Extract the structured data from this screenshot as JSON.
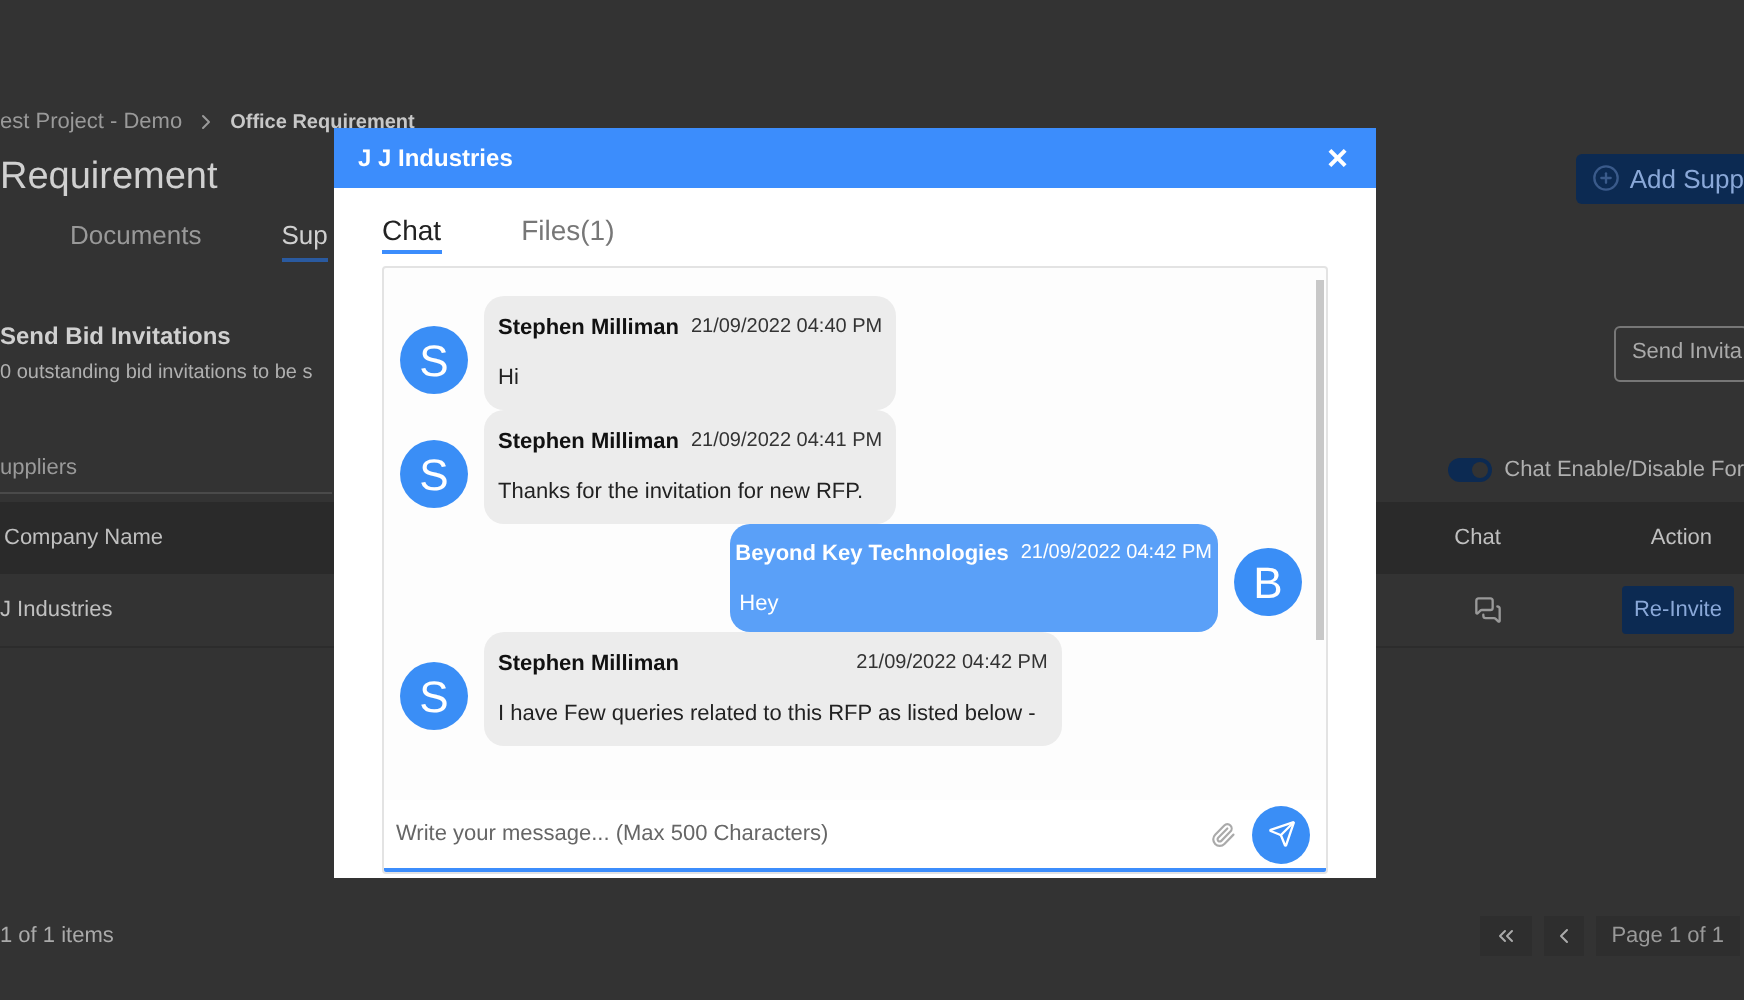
{
  "page": {
    "breadcrumb": [
      {
        "label": "est Project - Demo",
        "current": false
      },
      {
        "label": "Office Requirement",
        "current": true
      }
    ],
    "title": "Requirement",
    "add_button": "Add Supp",
    "tabs": [
      {
        "label": "Documents",
        "selected": false
      },
      {
        "label": "Sup",
        "selected": true
      }
    ],
    "section_title": "Send Bid Invitations",
    "section_subtitle": "0 outstanding bid invitations to be s",
    "send_button": "Send Invita",
    "search": {
      "placeholder": "uppliers"
    },
    "chat_toggle": {
      "label": "Chat Enable/Disable For",
      "on": true
    },
    "table": {
      "columns": [
        "Company Name",
        "Chat",
        "Action"
      ],
      "rows": [
        {
          "company": "J Industries",
          "action": "Re-Invite"
        }
      ]
    },
    "footer": {
      "count": "1 of 1 items",
      "page": "Page 1 of 1"
    }
  },
  "dialog": {
    "title": "J J Industries",
    "close": "×",
    "tabs": [
      {
        "label": "Chat",
        "selected": true
      },
      {
        "label": "Files(1)",
        "selected": false
      }
    ],
    "messages": [
      {
        "kind": "in",
        "avatar": "S",
        "sender": "Stephen Milliman",
        "time": "21/09/2022 04:40 PM",
        "text": "Hi"
      },
      {
        "kind": "in",
        "avatar": "S",
        "sender": "Stephen Milliman",
        "time": "21/09/2022 04:41 PM",
        "text": "Thanks for the invitation for new RFP."
      },
      {
        "kind": "out",
        "avatar": "B",
        "sender": "Beyond Key Technologies",
        "time": "21/09/2022 04:42 PM",
        "text": "Hey"
      },
      {
        "kind": "in",
        "avatar": "S",
        "sender": "Stephen Milliman",
        "time": "21/09/2022 04:42 PM",
        "text": "I have Few queries related to this RFP as listed below -"
      }
    ],
    "input": {
      "placeholder": "Write your message... (Max 500 Characters)"
    }
  }
}
